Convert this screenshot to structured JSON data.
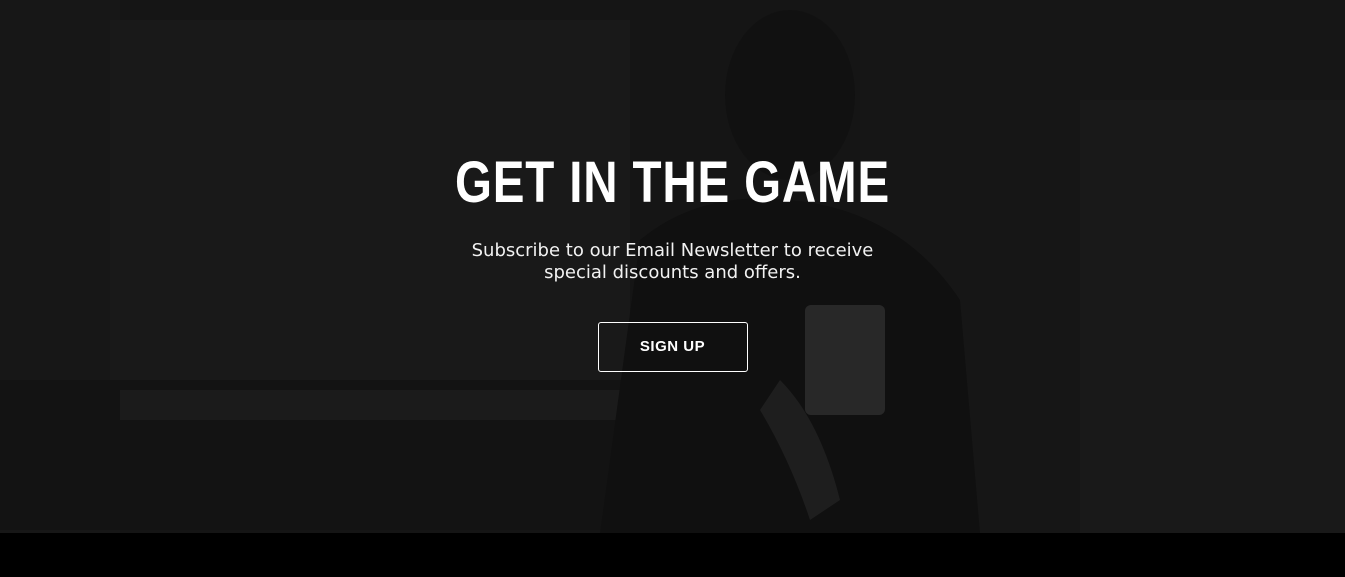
{
  "hero": {
    "title": "GET IN THE GAME",
    "subtitle": "Subscribe to our Email Newsletter to receive special discounts and offers.",
    "cta_label": "SIGN UP",
    "background_image": "man-kneeling-basketball-court-photo"
  },
  "colors": {
    "overlay": "#1b1b1b",
    "text": "#ffffff",
    "footer": "#000000"
  }
}
